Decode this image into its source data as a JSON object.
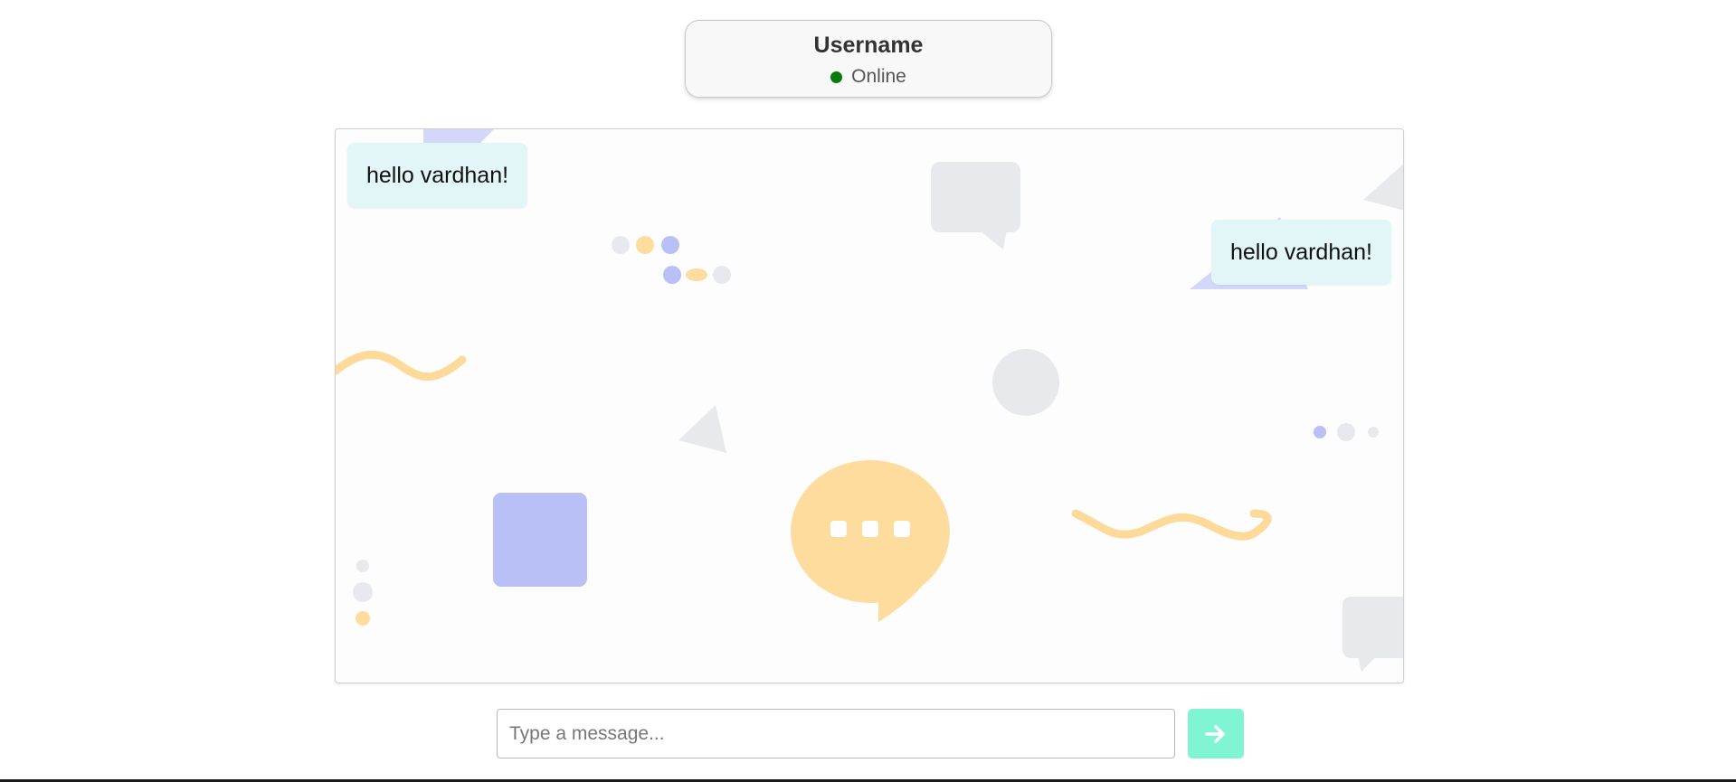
{
  "header": {
    "username": "Username",
    "status": "Online",
    "status_color": "#0a7a0a"
  },
  "messages": [
    {
      "text": "hello vardhan!",
      "side": "left"
    },
    {
      "text": "hello vardhan!",
      "side": "right"
    }
  ],
  "composer": {
    "placeholder": "Type a message...",
    "value": "",
    "send_icon": "arrow-right-icon",
    "send_color": "#7ff5d3"
  },
  "colors": {
    "bubble": "#e2f6f8",
    "accent_yellow": "#fddc9e",
    "accent_blue": "#b8c0f5",
    "accent_gray": "#e8e9ec"
  }
}
